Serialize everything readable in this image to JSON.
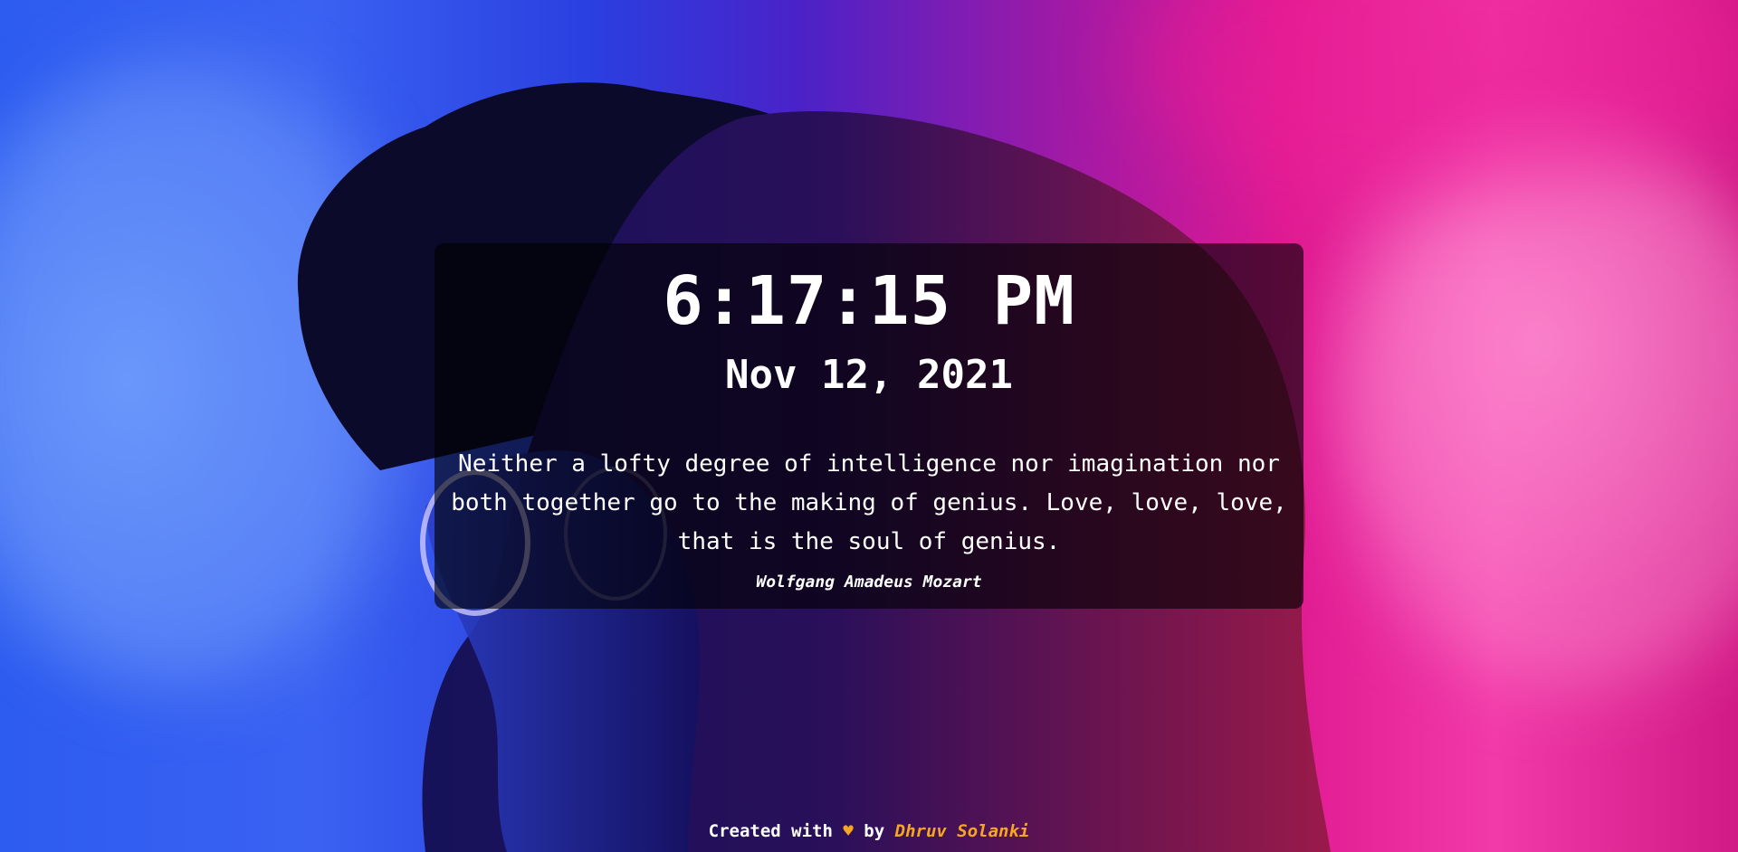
{
  "clock": {
    "time": "6:17:15 PM",
    "date": "Nov 12, 2021"
  },
  "quote": {
    "text": "Neither a lofty degree of intelligence nor imagination nor both together go to the making of genius. Love, love, love, that is the soul of genius.",
    "author": "Wolfgang Amadeus Mozart"
  },
  "footer": {
    "prefix": "Created with",
    "heart": "♥",
    "by": "by",
    "creator": "Dhruv Solanki"
  },
  "colors": {
    "accent": "#f5a623",
    "background_left": "#2d5cf0",
    "background_right": "#e01a92"
  }
}
